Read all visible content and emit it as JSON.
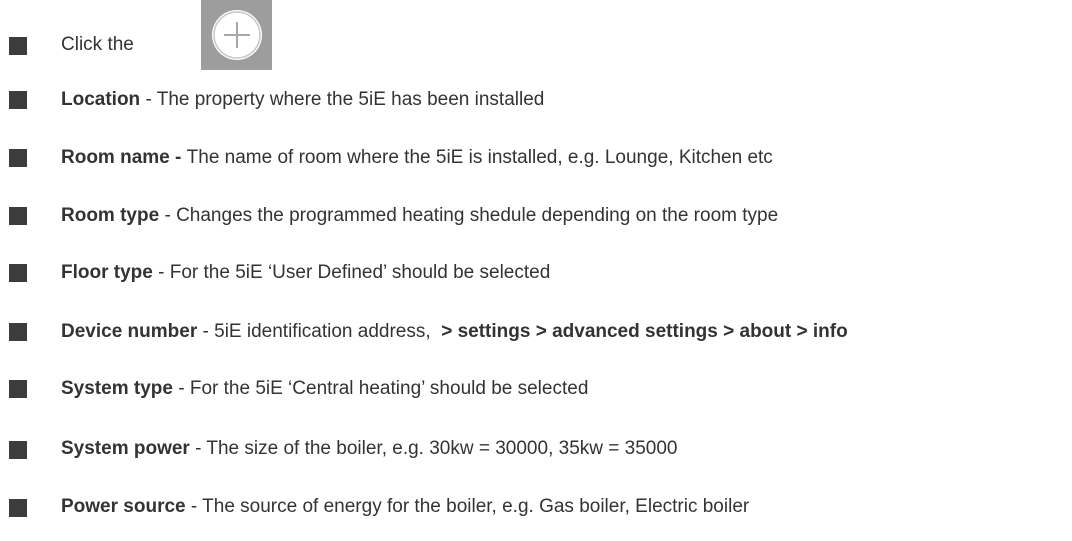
{
  "intro": {
    "text": "Click the",
    "button_icon": "plus-circle-icon"
  },
  "items": [
    {
      "term": "Location",
      "sep": " - ",
      "desc": "The property where the 5iE has been installed",
      "path": ""
    },
    {
      "term": "Room name",
      "sep": " - ",
      "desc": "The name of room where the 5iE is installed, e.g. Lounge, Kitchen etc",
      "path": ""
    },
    {
      "term": "Room type",
      "sep": " - ",
      "desc": "Changes the programmed heating shedule depending on the room type",
      "path": ""
    },
    {
      "term": "Floor type",
      "sep": " - ",
      "desc": "For the 5iE ‘User Defined’ should be selected",
      "path": ""
    },
    {
      "term": "Device number",
      "sep": " - ",
      "desc": "5iE identification address,",
      "path": "> settings > advanced settings > about > info"
    },
    {
      "term": "System type",
      "sep": " - ",
      "desc": "For the 5iE ‘Central heating’ should be selected",
      "path": ""
    },
    {
      "term": "System power",
      "sep": " - ",
      "desc": "The size of the boiler, e.g. 30kw = 30000, 35kw = 35000",
      "path": ""
    },
    {
      "term": "Power source",
      "sep": " - ",
      "desc": "The source of energy for the boiler, e.g. Gas boiler, Electric boiler",
      "path": ""
    }
  ],
  "colors": {
    "bullet": "#3c3c3c",
    "text": "#333333",
    "button_bg": "#9d9d9d"
  }
}
